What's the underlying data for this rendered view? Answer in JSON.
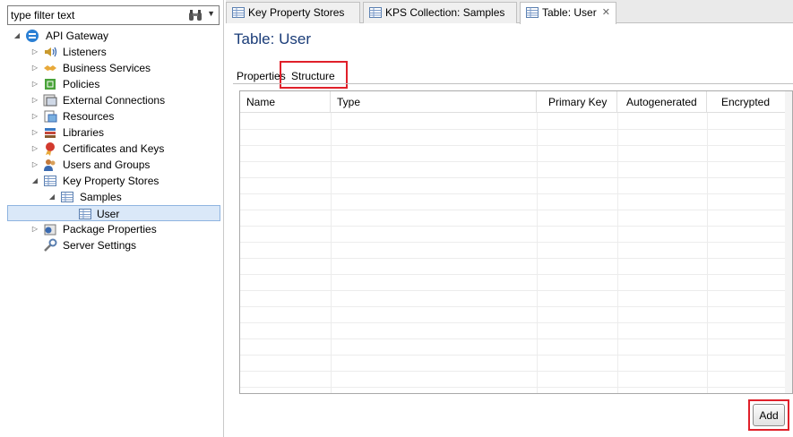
{
  "filter": {
    "value": "type filter text"
  },
  "tree": [
    {
      "label": "API Gateway",
      "icon": "api-gateway-icon"
    },
    {
      "label": "Listeners",
      "icon": "listeners-icon"
    },
    {
      "label": "Business Services",
      "icon": "business-services-icon"
    },
    {
      "label": "Policies",
      "icon": "policies-icon"
    },
    {
      "label": "External Connections",
      "icon": "external-connections-icon"
    },
    {
      "label": "Resources",
      "icon": "resources-icon"
    },
    {
      "label": "Libraries",
      "icon": "libraries-icon"
    },
    {
      "label": "Certificates and Keys",
      "icon": "certificates-icon"
    },
    {
      "label": "Users and Groups",
      "icon": "users-groups-icon"
    },
    {
      "label": "Key Property Stores",
      "icon": "table-icon"
    },
    {
      "label": "Samples",
      "icon": "table-icon"
    },
    {
      "label": "User",
      "icon": "table-icon"
    },
    {
      "label": "Package Properties",
      "icon": "package-icon"
    },
    {
      "label": "Server Settings",
      "icon": "wrench-icon"
    }
  ],
  "tabs": [
    {
      "label": "Key Property Stores"
    },
    {
      "label": "KPS Collection: Samples"
    },
    {
      "label": "Table: User"
    }
  ],
  "page": {
    "title": "Table: User"
  },
  "subtabs": [
    {
      "label": "Properties"
    },
    {
      "label": "Structure"
    }
  ],
  "table": {
    "columns": [
      "Name",
      "Type",
      "Primary Key",
      "Autogenerated",
      "Encrypted"
    ]
  },
  "buttons": {
    "add": "Add"
  },
  "colors": {
    "highlight": "#e0202a",
    "title": "#1a3c78",
    "selection": "#dae8f8"
  }
}
